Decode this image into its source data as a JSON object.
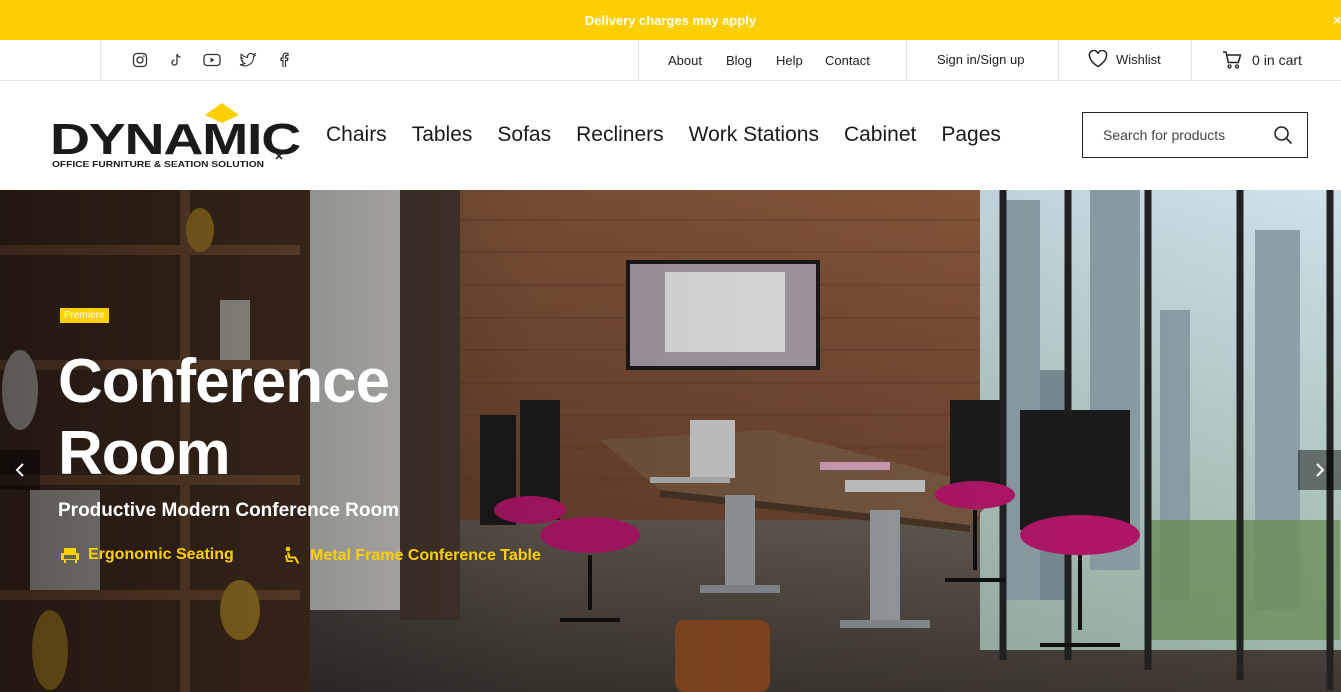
{
  "announcement": {
    "text": "Delivery charges may apply",
    "close_label": "×"
  },
  "topbar": {
    "social_icons": [
      "instagram-icon",
      "tiktok-icon",
      "youtube-icon",
      "twitter-icon",
      "facebook-icon"
    ],
    "links": [
      "About",
      "Blog",
      "Help",
      "Contact"
    ],
    "signin": "Sign in/Sign up",
    "wishlist": "Wishlist",
    "cart_count": "0",
    "cart_label": "in cart"
  },
  "header": {
    "logo_text": "DYNAMIC",
    "logo_tagline": "OFFICE FURNITURE & SEATION SOLUTION",
    "nav": [
      "Chairs",
      "Tables",
      "Sofas",
      "Recliners",
      "Work Stations",
      "Cabinet",
      "Pages"
    ],
    "search_placeholder": "Search for products"
  },
  "hero": {
    "badge": "Premiere",
    "title_line1": "Conference",
    "title_line2": "Room",
    "subtitle": "Productive Modern Conference Room",
    "features": [
      "Ergonomic Seating",
      "Metal Frame Conference Table"
    ],
    "prev_icon": "chevron-left-icon",
    "next_icon": "chevron-right-icon"
  },
  "colors": {
    "accent": "#fcd000",
    "text": "#111111",
    "chair": "#b5176a"
  }
}
